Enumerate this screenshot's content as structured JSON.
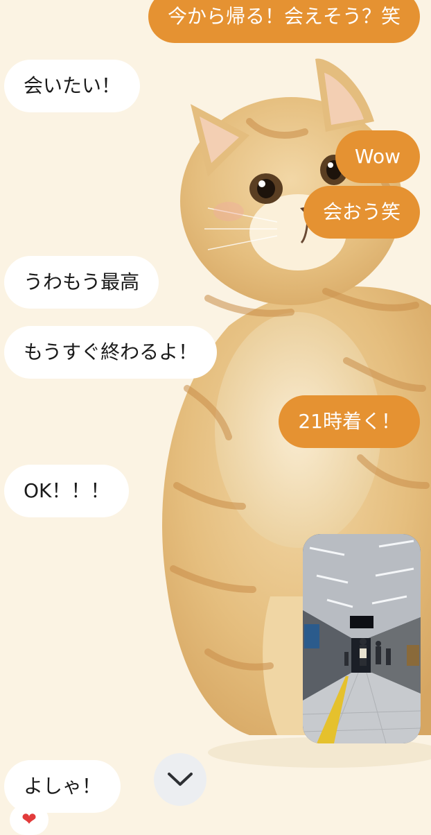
{
  "colors": {
    "background": "#fbf3e3",
    "outgoing_bubble": "#e59232",
    "incoming_bubble": "#ffffff",
    "reaction_heart": "#e23b3b"
  },
  "icons": {
    "scroll_down": "chevron-down-icon",
    "reaction": "heart-icon",
    "reaction_glyph": "❤"
  },
  "messages": [
    {
      "direction": "out",
      "text": "今から帰る！会えそう？笑"
    },
    {
      "direction": "in",
      "text": "会いたい！"
    },
    {
      "direction": "out",
      "text": "Wow"
    },
    {
      "direction": "out",
      "text": "会おう笑"
    },
    {
      "direction": "in",
      "text": "うわもう最高"
    },
    {
      "direction": "in",
      "text": "もうすぐ終わるよ！"
    },
    {
      "direction": "out",
      "text": "21時着く！"
    },
    {
      "direction": "in",
      "text": "OK！！！"
    },
    {
      "direction": "out",
      "type": "photo"
    },
    {
      "direction": "in",
      "text": "よしゃ！"
    }
  ]
}
